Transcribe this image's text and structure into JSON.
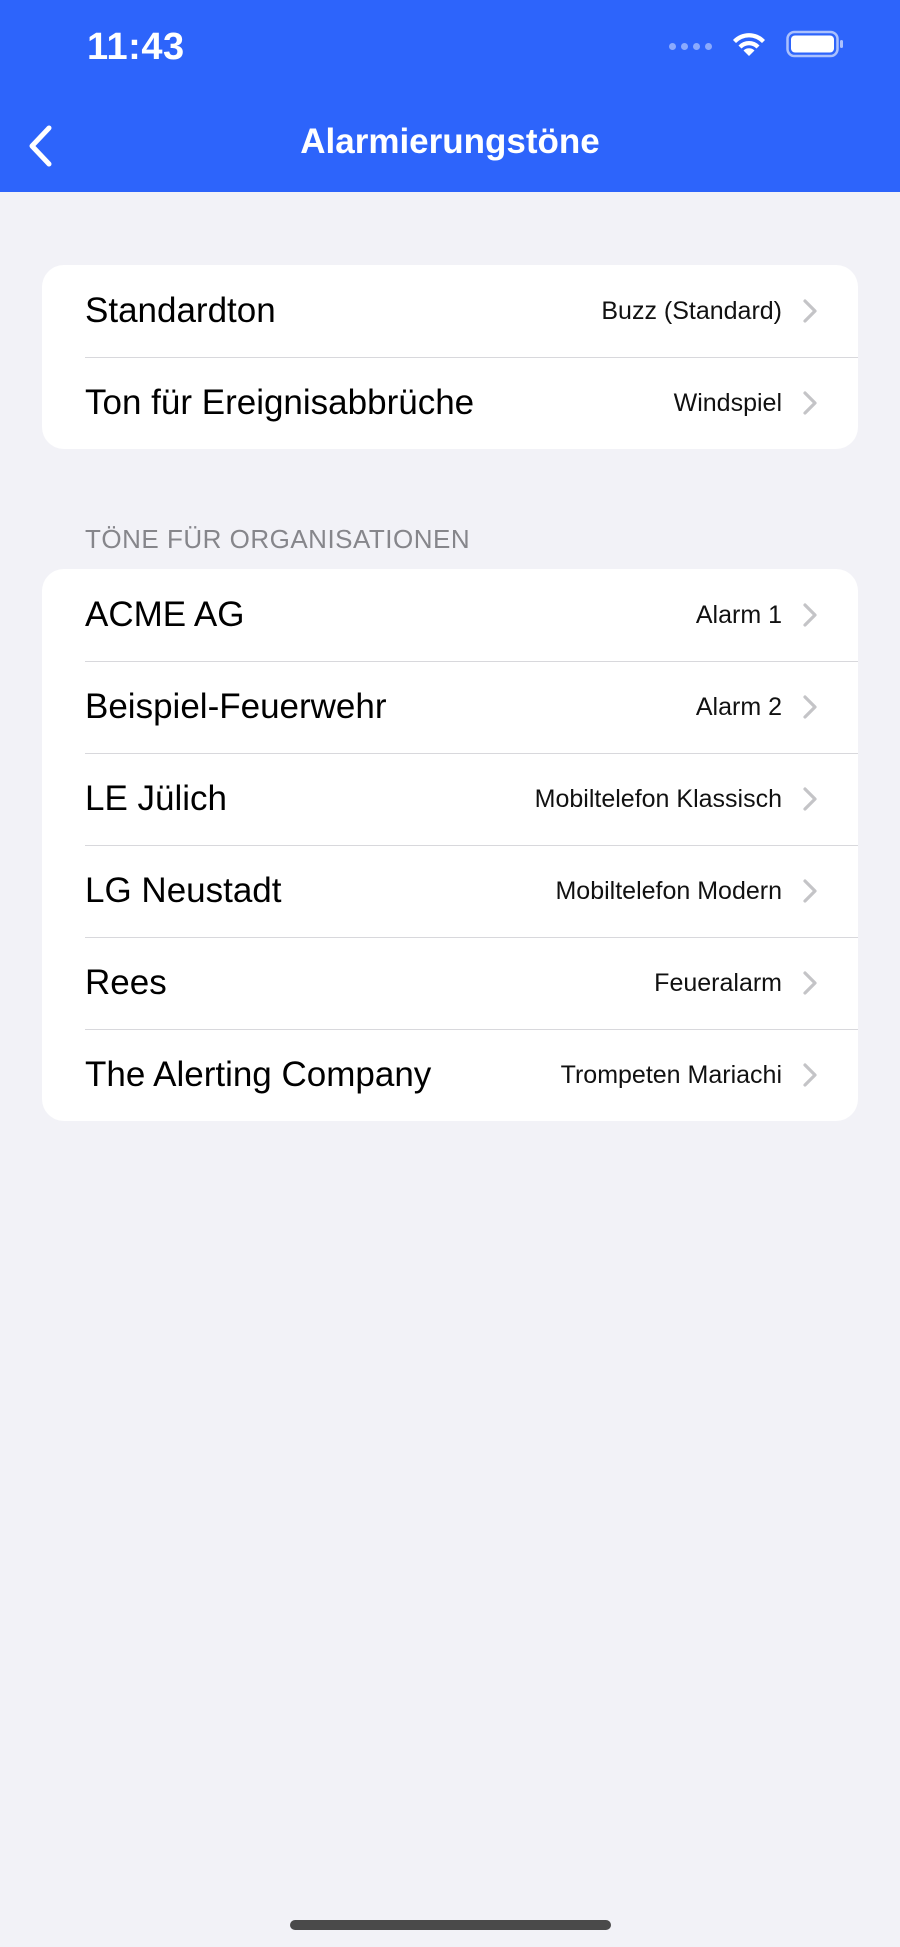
{
  "status_bar": {
    "time": "11:43"
  },
  "nav": {
    "title": "Alarmierungstöne",
    "back_icon": "chevron-left-icon"
  },
  "general_group": {
    "items": [
      {
        "label": "Standardton",
        "value": "Buzz (Standard)"
      },
      {
        "label": "Ton für Ereignisabbrüche",
        "value": "Windspiel"
      }
    ]
  },
  "organizations_group": {
    "header": "TÖNE FÜR ORGANISATIONEN",
    "items": [
      {
        "label": "ACME AG",
        "value": "Alarm 1"
      },
      {
        "label": "Beispiel-Feuerwehr",
        "value": "Alarm 2"
      },
      {
        "label": "LE Jülich",
        "value": "Mobiltelefon Klassisch"
      },
      {
        "label": "LG Neustadt",
        "value": "Mobiltelefon Modern"
      },
      {
        "label": "Rees",
        "value": "Feueralarm"
      },
      {
        "label": "The Alerting Company",
        "value": "Trompeten Mariachi"
      }
    ]
  },
  "colors": {
    "header_bg": "#2d64fb",
    "page_bg": "#f2f2f7",
    "chevron": "#c4c4c7"
  }
}
